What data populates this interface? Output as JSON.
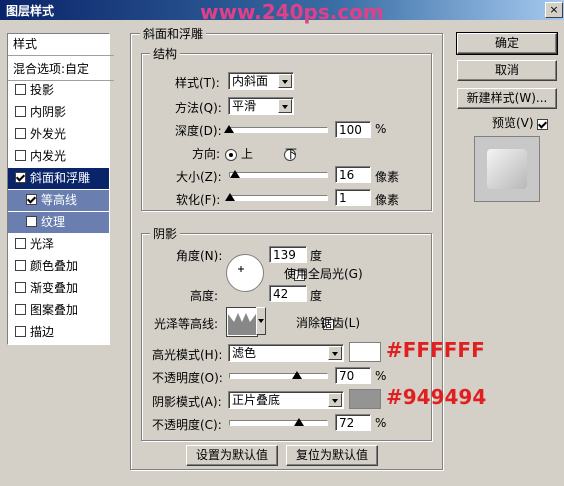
{
  "window": {
    "title": "图层样式",
    "watermark": "www.240ps.com",
    "close_glyph": "×"
  },
  "left_panel": {
    "title": "样式",
    "blend": "混合选项:自定",
    "items": [
      {
        "label": "投影",
        "checked": false
      },
      {
        "label": "内阴影",
        "checked": false
      },
      {
        "label": "外发光",
        "checked": false
      },
      {
        "label": "内发光",
        "checked": false
      },
      {
        "label": "斜面和浮雕",
        "checked": true
      },
      {
        "label": "等高线",
        "checked": true
      },
      {
        "label": "纹理",
        "checked": false
      },
      {
        "label": "光泽",
        "checked": false
      },
      {
        "label": "颜色叠加",
        "checked": false
      },
      {
        "label": "渐变叠加",
        "checked": false
      },
      {
        "label": "图案叠加",
        "checked": false
      },
      {
        "label": "描边",
        "checked": false
      }
    ]
  },
  "bevel": {
    "title": "斜面和浮雕",
    "structure_title": "结构",
    "style_label": "样式(T):",
    "style_value": "内斜面",
    "technique_label": "方法(Q):",
    "technique_value": "平滑",
    "depth_label": "深度(D):",
    "depth_value": "100",
    "depth_unit": "%",
    "depth_level": 1.0,
    "direction_label": "方向:",
    "dir_up": "上",
    "dir_down": "下",
    "size_label": "大小(Z):",
    "size_value": "16",
    "size_unit": "像素",
    "size_level": 0.06,
    "soften_label": "软化(F):",
    "soften_value": "1",
    "soften_unit": "像素",
    "soften_level": 0.01
  },
  "shading": {
    "title": "阴影",
    "angle_label": "角度(N):",
    "angle_value": "139",
    "angle_unit": "度",
    "global_light_label": "使用全局光(G)",
    "altitude_label": "高度:",
    "altitude_value": "42",
    "altitude_unit": "度",
    "gloss_label": "光泽等高线:",
    "antialias_label": "消除锯齿(L)",
    "highlight_mode_label": "高光模式(H):",
    "highlight_mode_value": "滤色",
    "highlight_color": "#FFFFFF",
    "highlight_hex": "#FFFFFF",
    "highlight_opacity_label": "不透明度(O):",
    "highlight_opacity_value": "70",
    "highlight_opacity_unit": "%",
    "highlight_opacity_level": 0.7,
    "shadow_mode_label": "阴影模式(A):",
    "shadow_mode_value": "正片叠底",
    "shadow_color": "#949494",
    "shadow_hex": "#949494",
    "shadow_opacity_label": "不透明度(C):",
    "shadow_opacity_value": "72",
    "shadow_opacity_unit": "%",
    "shadow_opacity_level": 0.72
  },
  "bottom": {
    "set_default": "设置为默认值",
    "reset_default": "复位为默认值"
  },
  "right": {
    "ok": "确定",
    "cancel": "取消",
    "new_style": "新建样式(W)...",
    "preview_label": "预览(V)"
  }
}
